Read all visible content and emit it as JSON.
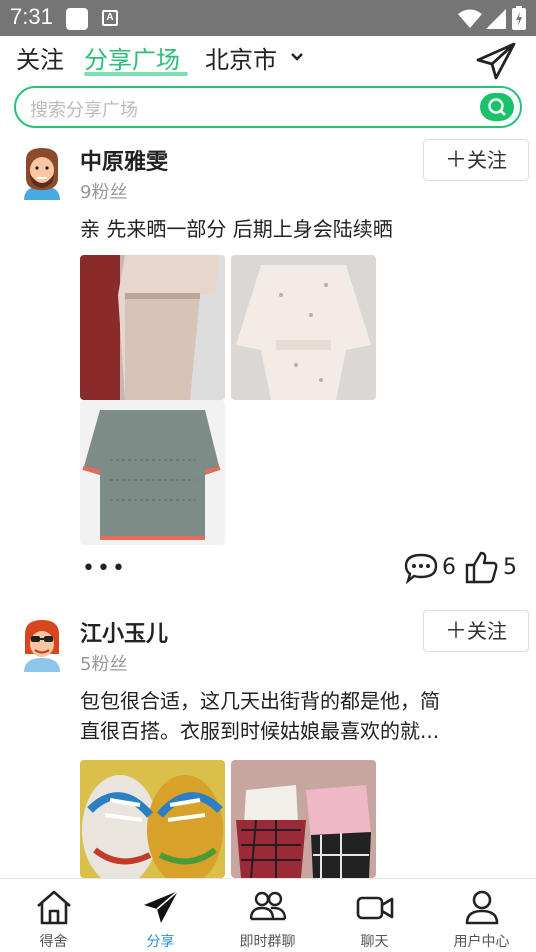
{
  "status_bar": {
    "time": "7:31"
  },
  "top_nav": {
    "tab_follow": "关注",
    "tab_square": "分享广场",
    "city": "北京市"
  },
  "search": {
    "placeholder": "搜索分享广场"
  },
  "posts": [
    {
      "username": "中原雅雯",
      "fans": "9粉丝",
      "follow_label": "关注",
      "text": "亲 先来晒一部分 后期上身会陆续晒",
      "more": "•••",
      "comments": "6",
      "likes": "5"
    },
    {
      "username": "江小玉儿",
      "fans": "5粉丝",
      "follow_label": "关注",
      "text_line1": "包包很合适，这几天出街背的都是他，简",
      "text_line2": "直很百搭。衣服到时候姑娘最喜欢的就..."
    }
  ],
  "bottom_nav": [
    {
      "label": "得舍",
      "icon": "home-icon"
    },
    {
      "label": "分享",
      "icon": "send-icon"
    },
    {
      "label": "即时群聊",
      "icon": "group-icon"
    },
    {
      "label": "聊天",
      "icon": "video-icon"
    },
    {
      "label": "用户中心",
      "icon": "user-icon"
    }
  ],
  "colors": {
    "accent": "#2bc07a",
    "active_nav": "#2a8de0",
    "status_bar": "#757575"
  }
}
